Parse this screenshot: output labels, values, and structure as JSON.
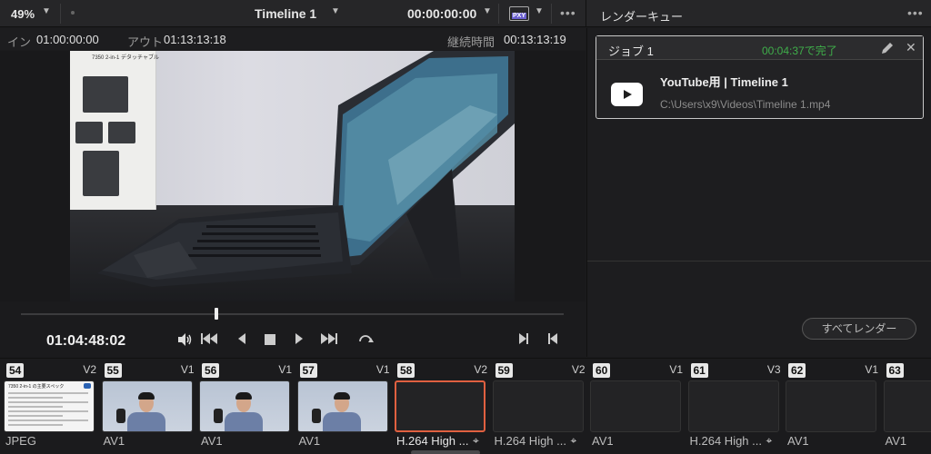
{
  "toolbar": {
    "zoom": "49%",
    "timeline_name": "Timeline 1",
    "timecode": "00:00:00:00",
    "proxy_badge": "PXY",
    "render_queue_title": "レンダーキュー"
  },
  "inout": {
    "in_label": "イン",
    "in_value": "01:00:00:00",
    "out_label": "アウト",
    "out_value": "01:13:13:18",
    "duration_label": "継続時間",
    "duration_value": "00:13:13:19"
  },
  "viewer": {
    "box_text": "7350 2-in-1 デタッチャブル",
    "current_timecode": "01:04:48:02",
    "playhead_fraction": 0.36
  },
  "render_queue": {
    "job_title": "ジョブ 1",
    "job_status": "00:04:37で完了",
    "job_name": "YouTube用 | Timeline 1",
    "job_path": "C:\\Users\\x9\\Videos\\Timeline 1.mp4",
    "render_all_label": "すべてレンダー"
  },
  "clips": [
    {
      "num": "54",
      "track": "V2",
      "codec": "JPEG",
      "thumb": "doc",
      "doc_title": "7350 2-in-1 の主要スペック"
    },
    {
      "num": "55",
      "track": "V1",
      "codec": "AV1",
      "thumb": "person"
    },
    {
      "num": "56",
      "track": "V1",
      "codec": "AV1",
      "thumb": "person"
    },
    {
      "num": "57",
      "track": "V1",
      "codec": "AV1",
      "thumb": "person"
    },
    {
      "num": "58",
      "track": "V2",
      "codec": "H.264 High ...",
      "thumb": "empty-selected"
    },
    {
      "num": "59",
      "track": "V2",
      "codec": "H.264 High ...",
      "thumb": "empty"
    },
    {
      "num": "60",
      "track": "V1",
      "codec": "AV1",
      "thumb": "empty"
    },
    {
      "num": "61",
      "track": "V3",
      "codec": "H.264 High ...",
      "thumb": "empty"
    },
    {
      "num": "62",
      "track": "V1",
      "codec": "AV1",
      "thumb": "empty"
    },
    {
      "num": "63",
      "track": "",
      "codec": "AV1",
      "thumb": "empty"
    }
  ],
  "icons": {
    "volume": "volume-icon",
    "first_frame": "skip-back-icon",
    "prev_frame": "play-reverse-icon",
    "stop": "stop-icon",
    "play": "play-icon",
    "next": "skip-forward-icon",
    "loop": "loop-icon",
    "edit": "pencil-icon",
    "close": "close-icon",
    "youtube": "youtube-icon"
  },
  "colors": {
    "status_green": "#3fae4a",
    "selected_clip": "#e06040"
  }
}
